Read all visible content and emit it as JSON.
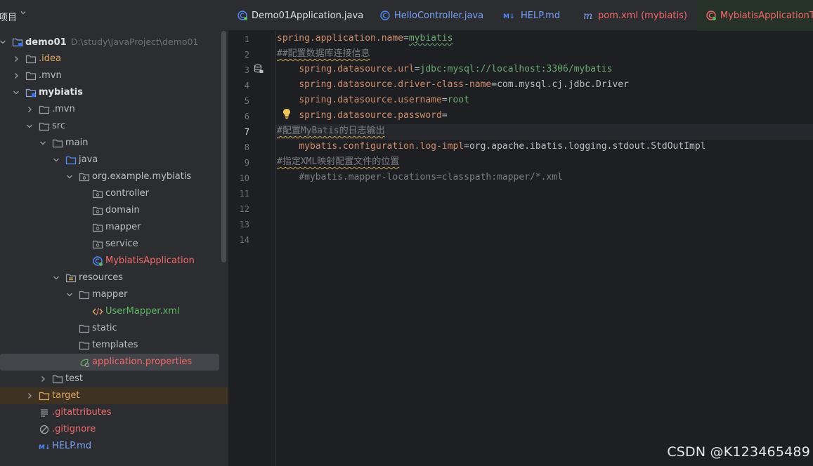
{
  "project_panel": {
    "title": "项目",
    "tree": [
      {
        "label": "demo01",
        "path": "D:\\study\\JavaProject\\demo01",
        "bold": true
      },
      {
        "label": ".idea"
      },
      {
        "label": ".mvn"
      },
      {
        "label": "mybiatis",
        "bold": true
      },
      {
        "label": ".mvn"
      },
      {
        "label": "src"
      },
      {
        "label": "main"
      },
      {
        "label": "java"
      },
      {
        "label": "org.example.mybiatis"
      },
      {
        "label": "controller"
      },
      {
        "label": "domain"
      },
      {
        "label": "mapper"
      },
      {
        "label": "service"
      },
      {
        "label": "MybiatisApplication"
      },
      {
        "label": "resources"
      },
      {
        "label": "mapper"
      },
      {
        "label": "UserMapper.xml"
      },
      {
        "label": "static"
      },
      {
        "label": "templates"
      },
      {
        "label": "application.properties"
      },
      {
        "label": "test"
      },
      {
        "label": "target"
      },
      {
        "label": ".gitattributes"
      },
      {
        "label": ".gitignore"
      },
      {
        "label": "HELP.md"
      }
    ]
  },
  "tabs": [
    {
      "label": "Demo01Application.java"
    },
    {
      "label": "HelloController.java"
    },
    {
      "label": "HELP.md"
    },
    {
      "label": "pom.xml (mybiatis)"
    },
    {
      "label": "MybiatisApplicationTes"
    }
  ],
  "editor": {
    "line_numbers": [
      "1",
      "2",
      "3",
      "4",
      "5",
      "6",
      "7",
      "8",
      "9",
      "10",
      "11",
      "12",
      "13",
      "14"
    ],
    "current_line": 7,
    "lines": [
      {
        "key": "spring.application.name",
        "eq": "=",
        "value": "mybiatis"
      },
      {
        "comment": "##配置数据库连接信息"
      },
      {
        "key": "spring.datasource.url",
        "eq": "=",
        "value": "jdbc:mysql://localhost:3306/mybatis"
      },
      {
        "key": "spring.datasource.driver-class-name",
        "eq": "=",
        "value": "com.mysql.cj.jdbc.Driver"
      },
      {
        "key": "spring.datasource.username",
        "eq": "=",
        "value": "root"
      },
      {
        "key": "spring.datasource.password",
        "eq": "=",
        "value": ""
      },
      {
        "comment": "#配置MyBatis的日志输出"
      },
      {
        "key": "mybatis.configuration.log-impl",
        "eq": "=",
        "value": "org.apache.ibatis.logging.stdout.StdOutImpl"
      },
      {
        "comment": "#指定XML映射配置文件的位置"
      },
      {
        "comment": "#mybatis.mapper-locations=classpath:mapper/*.xml"
      }
    ]
  },
  "watermark": "CSDN @K123465489",
  "colors": {
    "key": "#cf8e6d",
    "value": "#6aab73",
    "comment": "#7a7e85",
    "background": "#1e1f22",
    "panel": "#2b2d30"
  }
}
